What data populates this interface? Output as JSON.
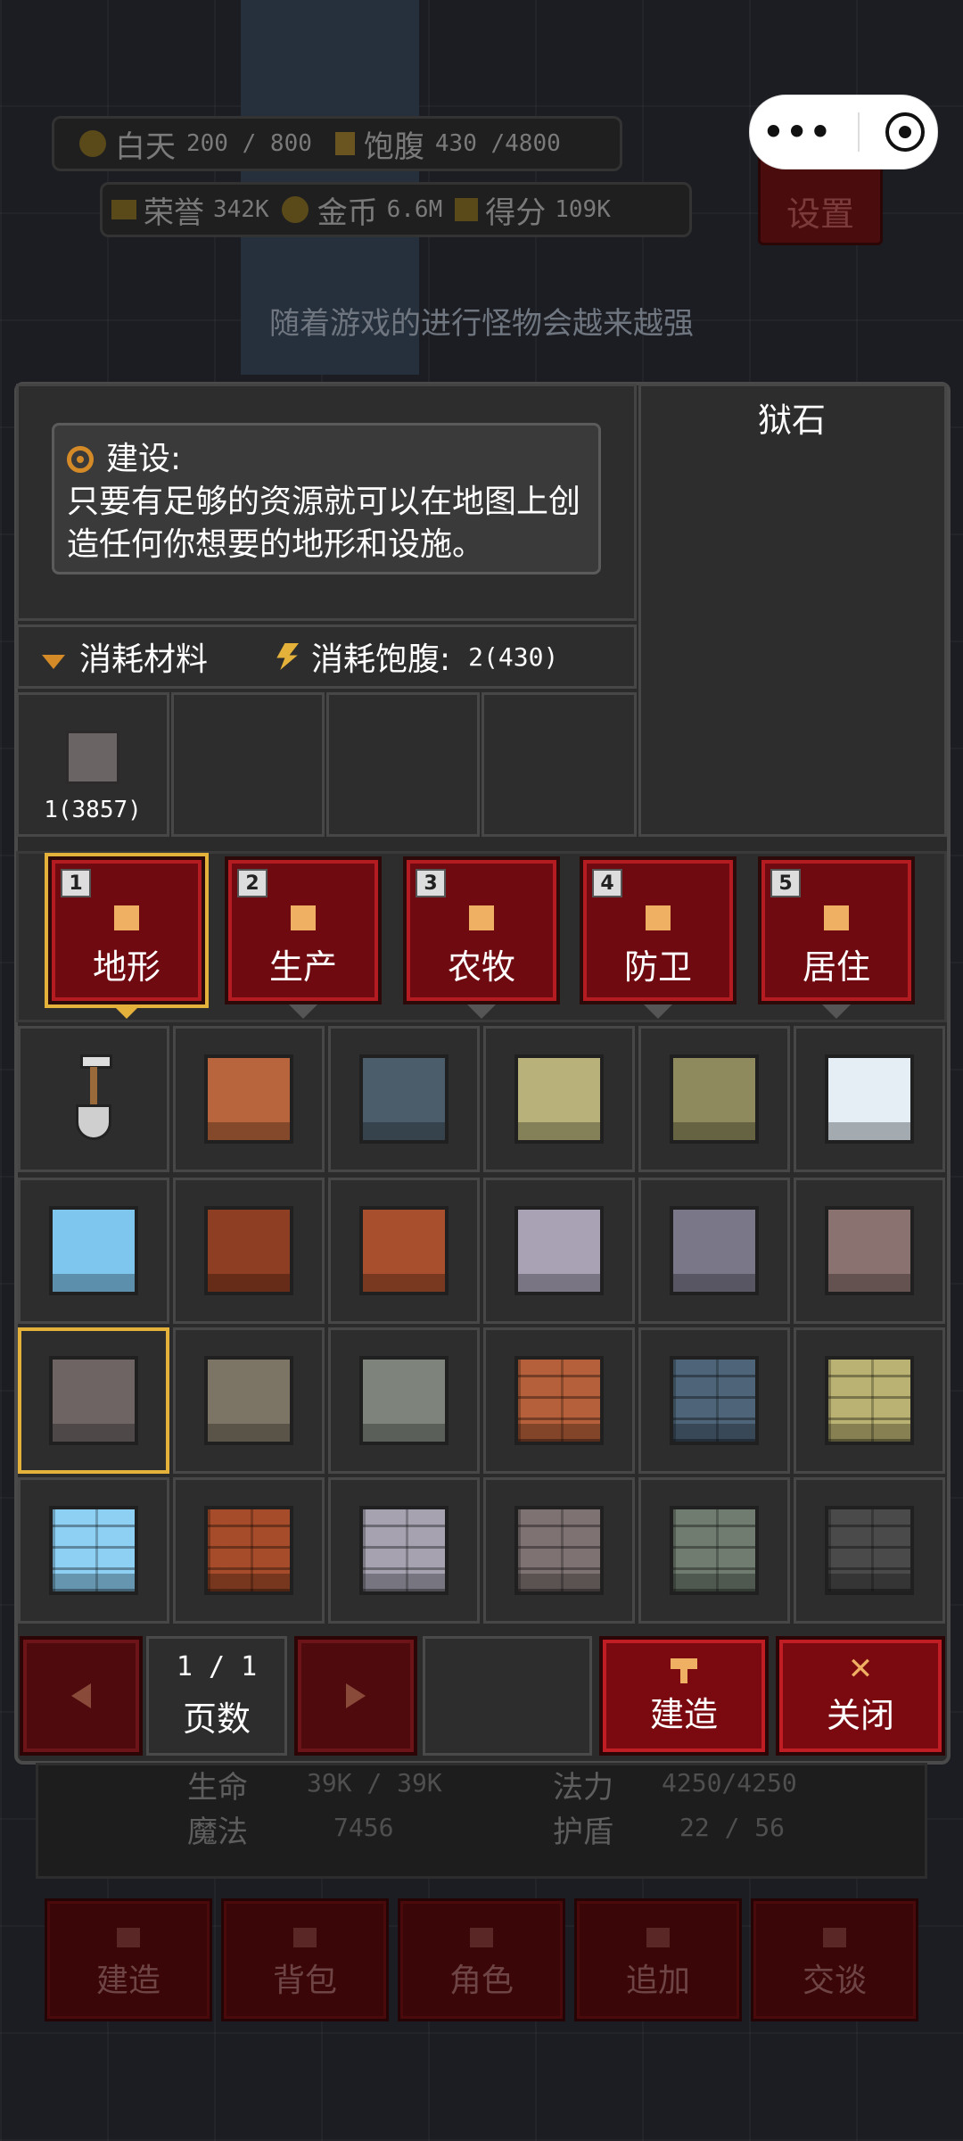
{
  "hud": {
    "day_label": "白天",
    "day_value": "200 / 800",
    "satiety_label": "饱腹",
    "satiety_value": "430 /4800",
    "honor_label": "荣誉",
    "honor_value": "342K",
    "gold_label": "金币",
    "gold_value": "6.6M",
    "score_label": "得分",
    "score_value": "109K",
    "settings_label": "设置",
    "hint": "随着游戏的进行怪物会越来越强"
  },
  "panel": {
    "desc_title": "建设:",
    "desc_text": "只要有足够的资源就可以在地图上创造任何你想要的地形和设施。",
    "selected_name": "狱石",
    "cost_material_label": "消耗材料",
    "cost_satiety_label": "消耗饱腹:",
    "cost_satiety_value": "2(430)",
    "material_count": "1(3857)"
  },
  "tabs": [
    {
      "num": "1",
      "label": "地形",
      "icon": "shovel-icon",
      "active": true
    },
    {
      "num": "2",
      "label": "生产",
      "icon": "anvil-icon",
      "active": false
    },
    {
      "num": "3",
      "label": "农牧",
      "icon": "sprout-icon",
      "active": false
    },
    {
      "num": "4",
      "label": "防卫",
      "icon": "shield-icon",
      "active": false
    },
    {
      "num": "5",
      "label": "居住",
      "icon": "diamond-icon",
      "active": false
    }
  ],
  "tiles": [
    {
      "name": "shovel-tool",
      "color": ""
    },
    {
      "name": "red-clay-block",
      "color": "#b8643c"
    },
    {
      "name": "slate-block",
      "color": "#4b5d6a"
    },
    {
      "name": "sandstone-block",
      "color": "#b8b27a"
    },
    {
      "name": "mossy-sandstone-block",
      "color": "#8e8a5e"
    },
    {
      "name": "snow-block",
      "color": "#e4eef4"
    },
    {
      "name": "ice-block",
      "color": "#7ec6ee"
    },
    {
      "name": "cracked-lava-block",
      "color": "#8e3e22"
    },
    {
      "name": "copper-block",
      "color": "#a8502e"
    },
    {
      "name": "silver-block",
      "color": "#a8a2b4"
    },
    {
      "name": "carved-gray-block",
      "color": "#7a7888"
    },
    {
      "name": "rune-stone-block",
      "color": "#8a7270"
    },
    {
      "name": "prison-stone-block",
      "color": "#6e6464"
    },
    {
      "name": "carved-sandstone-block",
      "color": "#7c7464"
    },
    {
      "name": "glyph-stone-block",
      "color": "#7e847c"
    },
    {
      "name": "orange-brick-block",
      "color": "#b5603a"
    },
    {
      "name": "blue-brick-block",
      "color": "#4e6478"
    },
    {
      "name": "yellow-brick-block",
      "color": "#bab272"
    },
    {
      "name": "ice-brick-block",
      "color": "#8ecff4"
    },
    {
      "name": "red-brick-block",
      "color": "#a64c2a"
    },
    {
      "name": "silver-brick-block",
      "color": "#a6a2b0"
    },
    {
      "name": "gray-brick-block",
      "color": "#7e7272"
    },
    {
      "name": "mossy-brick-block",
      "color": "#707c70"
    },
    {
      "name": "dark-stone-furnace",
      "color": "#4a4a4a"
    }
  ],
  "controls": {
    "page_value": "1 / 1",
    "page_label": "页数",
    "build_label": "建造",
    "close_label": "关闭"
  },
  "stats": {
    "hp_label": "生命",
    "hp_value": "39K / 39K",
    "mana_label": "法力",
    "mana_value": "4250/4250",
    "magic_label": "魔法",
    "magic_value": "7456",
    "shield_label": "护盾",
    "shield_value": "22 / 56"
  },
  "nav": {
    "build": "建造",
    "bag": "背包",
    "role": "角色",
    "add": "追加",
    "talk": "交谈"
  }
}
